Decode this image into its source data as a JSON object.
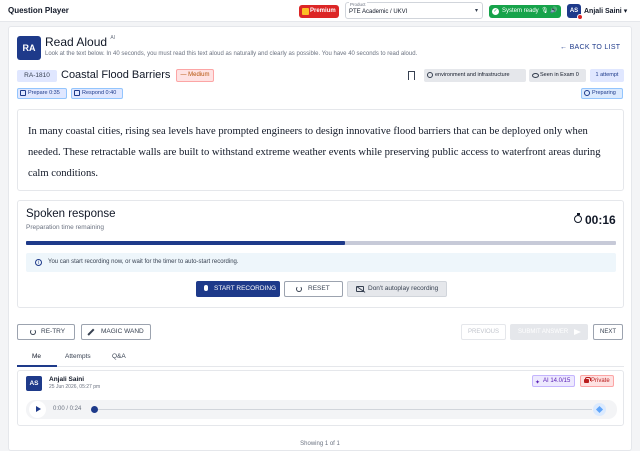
{
  "topbar": {
    "app_title": "Question Player",
    "premium_label": "Premium",
    "product": {
      "label": "Product",
      "value": "PTE Academic / UKVI"
    },
    "system_status": "System ready",
    "user": {
      "initials": "AS",
      "name": "Anjali Saini"
    }
  },
  "question": {
    "type_badge": "RA",
    "title": "Read Aloud",
    "title_sup": "AI",
    "instructions": "Look at the text below. In 40 seconds, you must read this text aloud as naturally and clearly as possible. You have 40 seconds to read aloud.",
    "back_label": "BACK TO LIST",
    "id": "RA-1810",
    "name": "Coastal Flood Barriers",
    "difficulty": "Medium",
    "tags": {
      "topic": "environment and infrastructure",
      "seen": "Seen in Exam 0",
      "attempts": "1 attempt"
    },
    "prepare": "Prepare 0:35",
    "respond": "Respond 0:40",
    "status": "Preparing",
    "passage": "In many coastal cities, rising sea levels have prompted engineers to design innovative flood barriers that can be deployed only when needed. These retractable walls are built to withstand extreme weather events while preserving public access to waterfront areas during calm conditions."
  },
  "spoken": {
    "title": "Spoken response",
    "subtitle": "Preparation time remaining",
    "timer": "00:16",
    "progress": 0.54,
    "info": "You can start recording now, or wait for the timer to auto-start recording.",
    "start_label": "START RECORDING",
    "reset_label": "RESET",
    "noautoplay_label": "Don't autoplay recording"
  },
  "actions": {
    "retry": "RE-TRY",
    "magic": "MAGIC WAND",
    "previous": "PREVIOUS",
    "submit": "SUBMIT ANSWER",
    "next": "NEXT"
  },
  "tabs": [
    "Me",
    "Attempts",
    "Q&A"
  ],
  "entry": {
    "initials": "AS",
    "name": "Anjali Saini",
    "date": "25 Jun 2026, 05:27 pm",
    "ai_score": "AI 14.0/15",
    "visibility": "Private",
    "audio_time": "0:00 / 0:24"
  },
  "footer": "Showing 1 of 1",
  "colors": {
    "primary": "#1e3a8a",
    "success": "#16a34a",
    "danger": "#dc2626"
  }
}
